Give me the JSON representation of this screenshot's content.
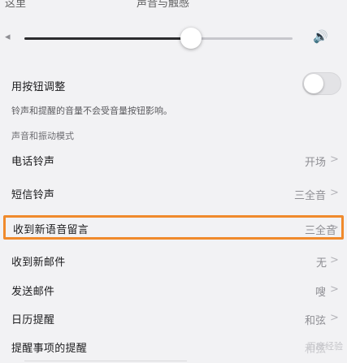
{
  "top_partial": {
    "left": "这里",
    "center": "声音与触感"
  },
  "volume": {
    "low_icon": "◂",
    "high_icon": "🔊",
    "level": 0.62,
    "low_icon_name": "speaker-low-icon",
    "high_icon_name": "speaker-high-icon"
  },
  "settings": {
    "change_with_buttons": {
      "label": "用按钮调整",
      "enabled": false
    },
    "description": "铃声和提醒的音量不会受音量按钮影响。",
    "section_header": "声音和振动模式",
    "rows": [
      {
        "label": "电话铃声",
        "value": "开场"
      },
      {
        "label": "短信铃声",
        "value": "三全音"
      },
      {
        "label": "收到新语音留言",
        "value": "三全音",
        "highlighted": true
      },
      {
        "label": "收到新邮件",
        "value": "无"
      },
      {
        "label": "发送邮件",
        "value": "嗖"
      },
      {
        "label": "日历提醒",
        "value": "和弦"
      },
      {
        "label": "提醒事项的提醒",
        "value": "和弦"
      }
    ],
    "chevron": ">"
  },
  "watermark": "百度经验"
}
